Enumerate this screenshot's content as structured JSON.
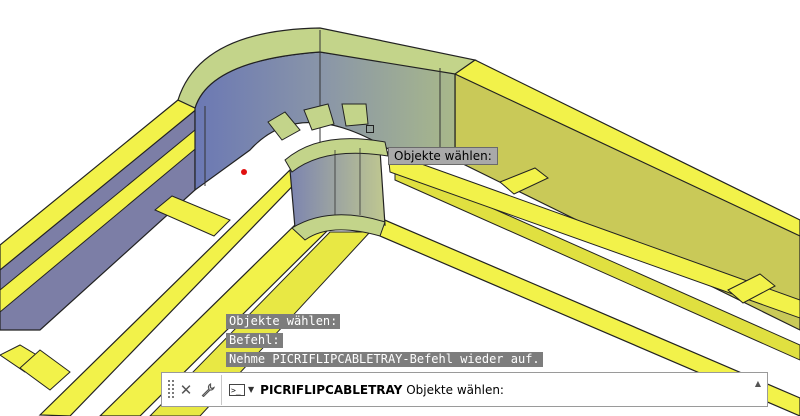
{
  "tooltip": {
    "text": "Objekte wählen:"
  },
  "history": [
    "Objekte wählen:",
    "Befehl:",
    "Nehme PICRIFLIPCABLETRAY-Befehl wieder auf."
  ],
  "command_line": {
    "command": "PICRIFLIPCABLETRAY",
    "prompt": "Objekte wählen:",
    "prompt_icon": ">_"
  },
  "icons": {
    "close": "close-icon",
    "customize": "wrench-icon",
    "recent_commands": "command-prompt-icon",
    "scroll_up": "chevron-up-icon",
    "grip": "grip-handle-icon"
  },
  "colors": {
    "tray_yellow": "#f2f24a",
    "tray_shadow": "#c9c958",
    "tray_inner_blue": "#7c7ea6",
    "bend_top": "#c3d48a",
    "tooltip_bg": "#a9a9a9",
    "history_bg": "#7d7d7d"
  }
}
